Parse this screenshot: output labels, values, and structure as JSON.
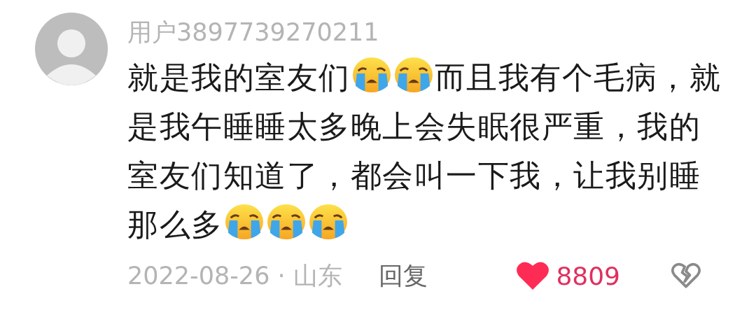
{
  "comment": {
    "username": "用户3897739270211",
    "body": [
      {
        "kind": "text",
        "text": "就是我的室友们"
      },
      {
        "kind": "emoji"
      },
      {
        "kind": "emoji"
      },
      {
        "kind": "text",
        "text": "而且我有个毛病，就是我午睡睡太多晚上会失眠很严重，我的室友们知道了，都会叫一下我，让我别睡那么多"
      },
      {
        "kind": "emoji"
      },
      {
        "kind": "emoji"
      },
      {
        "kind": "emoji"
      }
    ],
    "meta": "2022-08-26 · 山东",
    "reply": "回复",
    "liked": true,
    "likes": "8809"
  }
}
